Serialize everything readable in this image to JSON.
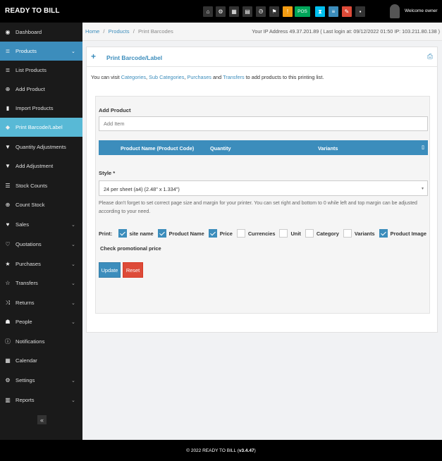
{
  "app": {
    "name": "READY TO BILL"
  },
  "topbar": {
    "pos_label": "POS",
    "welcome": "Welcome owner",
    "colors": {
      "yellow": "#f39c12",
      "green": "#00a65a",
      "teal": "#00c0ef",
      "blue": "#3c8dbc",
      "red": "#dd4b39",
      "dark": "#333333"
    }
  },
  "sidebar": {
    "items": [
      {
        "label": "Dashboard",
        "icon": "dashboard-icon",
        "expandable": false
      },
      {
        "label": "Products",
        "icon": "list-icon",
        "expandable": true,
        "active": true
      },
      {
        "label": "List Products",
        "icon": "list-icon",
        "expandable": false
      },
      {
        "label": "Add Product",
        "icon": "plus-circle-icon",
        "expandable": false
      },
      {
        "label": "Import Products",
        "icon": "file-icon",
        "expandable": false
      },
      {
        "label": "Print Barcode/Label",
        "icon": "tag-icon",
        "expandable": false,
        "selected": true
      },
      {
        "label": "Quantity Adjustments",
        "icon": "filter-icon",
        "expandable": false
      },
      {
        "label": "Add Adjustment",
        "icon": "filter-icon",
        "expandable": false
      },
      {
        "label": "Stock Counts",
        "icon": "list-ol-icon",
        "expandable": false
      },
      {
        "label": "Count Stock",
        "icon": "plus-circle-icon",
        "expandable": false
      },
      {
        "label": "Sales",
        "icon": "heart-icon",
        "expandable": true
      },
      {
        "label": "Quotations",
        "icon": "heart-outline-icon",
        "expandable": true
      },
      {
        "label": "Purchases",
        "icon": "star-icon",
        "expandable": true
      },
      {
        "label": "Transfers",
        "icon": "star-outline-icon",
        "expandable": true
      },
      {
        "label": "Returns",
        "icon": "random-icon",
        "expandable": true
      },
      {
        "label": "People",
        "icon": "users-icon",
        "expandable": true
      },
      {
        "label": "Notifications",
        "icon": "info-icon",
        "expandable": false
      },
      {
        "label": "Calendar",
        "icon": "calendar-icon",
        "expandable": false
      },
      {
        "label": "Settings",
        "icon": "cog-icon",
        "expandable": true
      },
      {
        "label": "Reports",
        "icon": "bar-chart-icon",
        "expandable": true
      }
    ],
    "collapse_label": "«"
  },
  "breadcrumb": {
    "home": "Home",
    "sep": "/",
    "products": "Products",
    "current": "Print Barcodes",
    "ip_info": "Your IP Address 49.37.201.89 ( Last login at: 09/12/2022 01:50 IP: 103.211.80.138 )"
  },
  "panel": {
    "title": "Print Barcode/Label",
    "intro_prefix": "You can visit",
    "link_categories": "Categories",
    "comma": ",",
    "link_subcategories": "Sub Categories",
    "link_purchases": "Purchases",
    "and": "and",
    "link_transfers": "Transfers",
    "intro_suffix": "to add products to this printing list.",
    "add_product_label": "Add Product",
    "add_item_placeholder": "Add Item",
    "table_headers": [
      "Product Name (Product Code)",
      "Quantity",
      "Variants"
    ],
    "style_label": "Style *",
    "style_value": "24 per sheet (a4) (2.48\" x 1.334\")",
    "note": "Please don't forget to set correct page size and margin for your printer. You can set right and bottom to 0 while left and top margin can be adjusted according to your need.",
    "print_label": "Print:",
    "print_options": [
      {
        "label": "site name",
        "checked": true
      },
      {
        "label": "Product Name",
        "checked": true
      },
      {
        "label": "Price",
        "checked": true
      },
      {
        "label": "Currencies",
        "checked": false
      },
      {
        "label": "Unit",
        "checked": false
      },
      {
        "label": "Category",
        "checked": false
      },
      {
        "label": "Variants",
        "checked": false
      },
      {
        "label": "Product Image",
        "checked": true
      }
    ],
    "promo_label": "Check promotional price",
    "update_button": "Update",
    "reset_button": "Reset"
  },
  "footer": {
    "prefix": "© 2022 READY TO BILL (",
    "version": "v3.4.47",
    "suffix": ")"
  }
}
